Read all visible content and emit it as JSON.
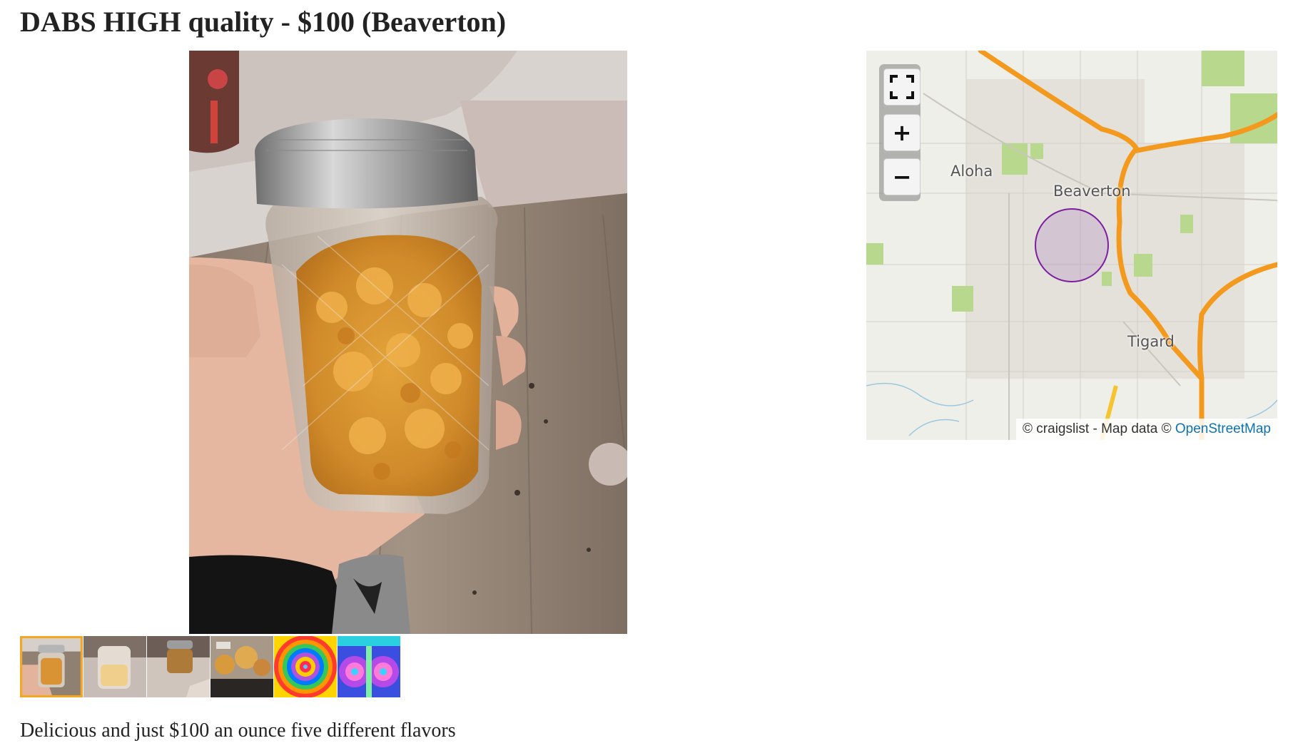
{
  "posting": {
    "title": "DABS HIGH quality - $100 (Beaverton)",
    "description": "Delicious and just $100 an ounce five different flavors"
  },
  "gallery": {
    "main_image": "jar-of-amber-concentrate-photo",
    "selected_index": 0,
    "thumbnails": [
      {
        "name": "jar-photo-thumb"
      },
      {
        "name": "jar-light-photo-thumb"
      },
      {
        "name": "jar-table-photo-thumb"
      },
      {
        "name": "jars-group-photo-thumb"
      },
      {
        "name": "psychedelic-spiral-thumb"
      },
      {
        "name": "psychedelic-swirl-thumb"
      }
    ]
  },
  "map": {
    "labels": {
      "aloha": "Aloha",
      "beaverton": "Beaverton",
      "tigard": "Tigard"
    },
    "controls": {
      "fullscreen_icon": "fullscreen-icon",
      "zoom_in": "+",
      "zoom_out": "−"
    },
    "attribution": {
      "text": "© craigslist - Map data © ",
      "link": "OpenStreetMap"
    },
    "colors": {
      "highway": "#f39a1e",
      "park": "#b8d88e",
      "area_circle": "#7a1fa0"
    }
  },
  "colors": {
    "selected_thumb_border": "#f5a623",
    "link": "#0f73ad"
  }
}
